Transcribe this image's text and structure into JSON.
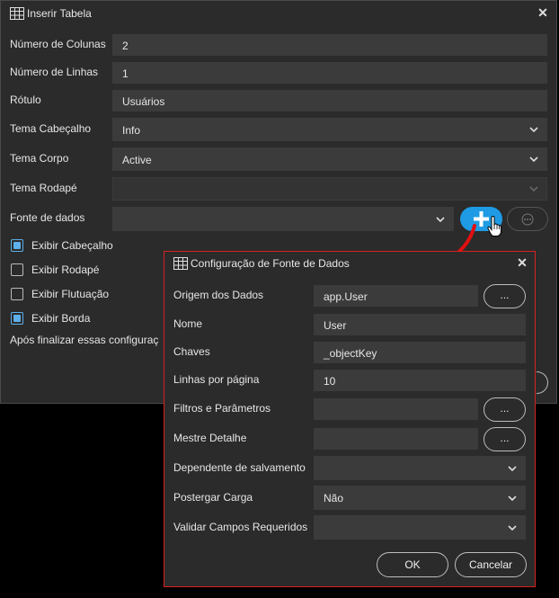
{
  "main_dialog": {
    "title": "Inserir Tabela",
    "close_icon": "close-icon",
    "fields": {
      "num_columns": {
        "label": "Número de Colunas",
        "value": "2"
      },
      "num_rows": {
        "label": "Número de Linhas",
        "value": "1"
      },
      "rotulo": {
        "label": "Rótulo",
        "value": "Usuários"
      },
      "tema_cabecalho": {
        "label": "Tema Cabeçalho",
        "value": "Info"
      },
      "tema_corpo": {
        "label": "Tema Corpo",
        "value": "Active"
      },
      "tema_rodape": {
        "label": "Tema Rodapé",
        "value": ""
      },
      "fonte_dados": {
        "label": "Fonte de dados",
        "value": ""
      }
    },
    "checkboxes": [
      {
        "label": "Exibir Cabeçalho",
        "checked": true
      },
      {
        "label": "Exibir Rodapé",
        "checked": false
      },
      {
        "label": "Exibir Flutuação",
        "checked": false
      },
      {
        "label": "Exibir Borda",
        "checked": true
      }
    ],
    "footer_text": "Após finalizar essas configuraç",
    "accent_color": "#1e9be4"
  },
  "datasource_dialog": {
    "title": "Configuração de Fonte de Dados",
    "fields": {
      "origem": {
        "label": "Origem dos Dados",
        "value": "app.User",
        "button": "..."
      },
      "nome": {
        "label": "Nome",
        "value": "User"
      },
      "chaves": {
        "label": "Chaves",
        "value": "_objectKey"
      },
      "linhas_pagina": {
        "label": "Linhas por página",
        "value": "10"
      },
      "filtros": {
        "label": "Filtros e Parâmetros",
        "value": "",
        "button": "..."
      },
      "mestre": {
        "label": "Mestre Detalhe",
        "value": "",
        "button": "..."
      },
      "dependente": {
        "label": "Dependente de salvamento",
        "value": ""
      },
      "postergar": {
        "label": "Postergar Carga",
        "value": "Não"
      },
      "validar": {
        "label": "Validar Campos Requeridos",
        "value": ""
      }
    },
    "ok_label": "OK",
    "cancel_label": "Cancelar",
    "border_color": "#d92020"
  }
}
